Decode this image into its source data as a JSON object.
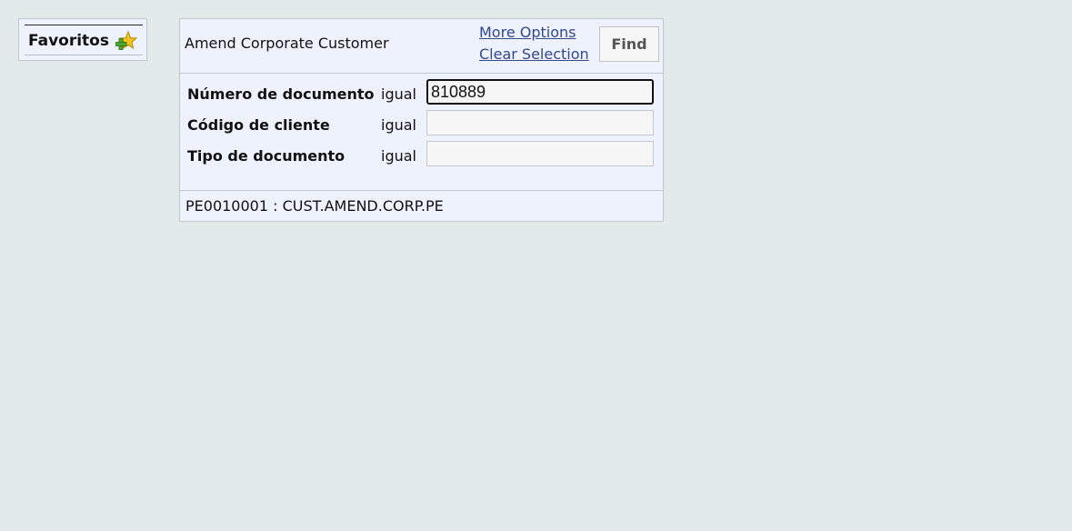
{
  "favorites": {
    "label": "Favoritos",
    "icon": "add-favorite-icon"
  },
  "form": {
    "title": "Amend Corporate Customer",
    "more_options": "More Options",
    "clear_selection": "Clear Selection",
    "find_label": "Find",
    "fields": [
      {
        "label": "Número de documento",
        "operator": "igual",
        "value": "810889"
      },
      {
        "label": "Código de cliente",
        "operator": "igual",
        "value": ""
      },
      {
        "label": "Tipo de documento",
        "operator": "igual",
        "value": ""
      }
    ],
    "footer": "PE0010001 : CUST.AMEND.CORP.PE"
  },
  "colors": {
    "background": "#e1eae9",
    "panel": "#edf2fc",
    "link": "#33488c"
  }
}
